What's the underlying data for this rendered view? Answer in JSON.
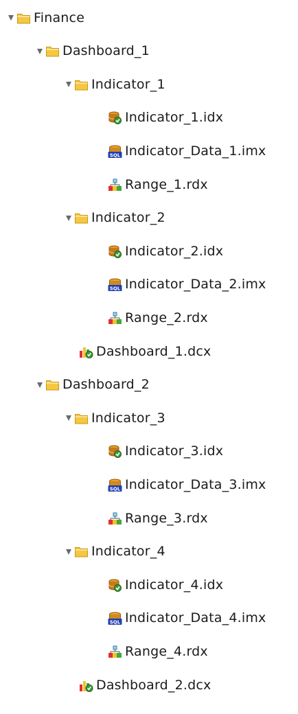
{
  "tree": {
    "items": [
      {
        "label": "Finance",
        "type": "folder",
        "depth": 0,
        "expanded": true
      },
      {
        "label": "Dashboard_1",
        "type": "folder",
        "depth": 1,
        "expanded": true
      },
      {
        "label": "Indicator_1",
        "type": "folder",
        "depth": 2,
        "expanded": true
      },
      {
        "label": "Indicator_1.idx",
        "type": "indicator-file",
        "depth": 3
      },
      {
        "label": "Indicator_Data_1.imx",
        "type": "sql-data-file",
        "depth": 3
      },
      {
        "label": "Range_1.rdx",
        "type": "range-file",
        "depth": 3
      },
      {
        "label": "Indicator_2",
        "type": "folder",
        "depth": 2,
        "expanded": true
      },
      {
        "label": "Indicator_2.idx",
        "type": "indicator-file",
        "depth": 3
      },
      {
        "label": "Indicator_Data_2.imx",
        "type": "sql-data-file",
        "depth": 3
      },
      {
        "label": "Range_2.rdx",
        "type": "range-file",
        "depth": 3
      },
      {
        "label": "Dashboard_1.dcx",
        "type": "dashboard-file",
        "depth": 2
      },
      {
        "label": "Dashboard_2",
        "type": "folder",
        "depth": 1,
        "expanded": true
      },
      {
        "label": "Indicator_3",
        "type": "folder",
        "depth": 2,
        "expanded": true
      },
      {
        "label": "Indicator_3.idx",
        "type": "indicator-file",
        "depth": 3
      },
      {
        "label": "Indicator_Data_3.imx",
        "type": "sql-data-file",
        "depth": 3
      },
      {
        "label": "Range_3.rdx",
        "type": "range-file",
        "depth": 3
      },
      {
        "label": "Indicator_4",
        "type": "folder",
        "depth": 2,
        "expanded": true
      },
      {
        "label": "Indicator_4.idx",
        "type": "indicator-file",
        "depth": 3
      },
      {
        "label": "Indicator_Data_4.imx",
        "type": "sql-data-file",
        "depth": 3
      },
      {
        "label": "Range_4.rdx",
        "type": "range-file",
        "depth": 3
      },
      {
        "label": "Dashboard_2.dcx",
        "type": "dashboard-file",
        "depth": 2
      }
    ]
  },
  "icons": {
    "folder": "folder-icon",
    "indicator-file": "indicator-file-icon",
    "sql-data-file": "sql-database-icon",
    "range-file": "range-file-icon",
    "dashboard-file": "dashboard-file-icon"
  },
  "colors": {
    "folder_fill": "#f5c842",
    "folder_outline": "#c89616",
    "caret": "#6a6a6a",
    "text": "#1a1a1a",
    "sql_blue": "#1f3fb3",
    "indicator_green": "#3e9a3a"
  }
}
